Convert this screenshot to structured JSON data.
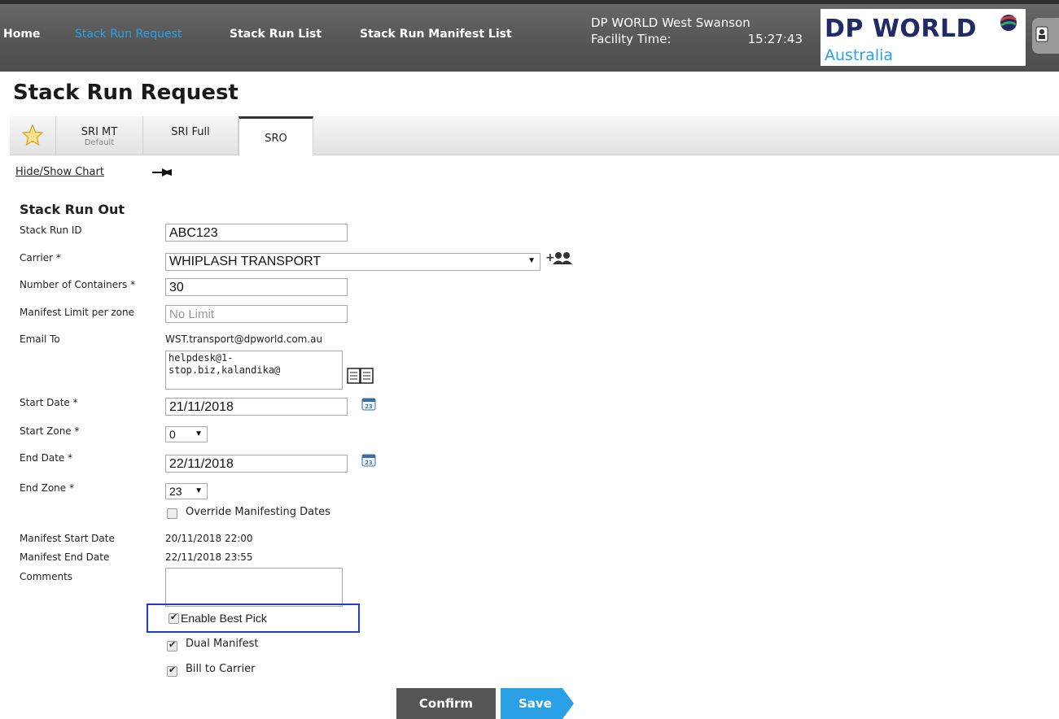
{
  "nav": {
    "home": "Home",
    "stack_run_request": "Stack Run Request",
    "stack_run_list": "Stack Run List",
    "stack_run_manifest_list": "Stack Run Manifest List"
  },
  "facility": {
    "name": "DP WORLD West Swanson",
    "time_label": "Facility Time:",
    "time": "15:27:43"
  },
  "logo": {
    "main": "DP WORLD",
    "sub": "Australia"
  },
  "page_title": "Stack Run Request",
  "tabs": [
    {
      "label": "SRI MT",
      "sub": "Default"
    },
    {
      "label": "SRI Full"
    },
    {
      "label": "SRO"
    }
  ],
  "hide_show_chart": "Hide/Show Chart",
  "section_title": "Stack Run Out",
  "form": {
    "stack_run_id": {
      "label": "Stack Run ID",
      "value": "ABC123"
    },
    "carrier": {
      "label": "Carrier *",
      "value": "WHIPLASH TRANSPORT"
    },
    "num_containers": {
      "label": "Number of Containers *",
      "value": "30"
    },
    "manifest_limit": {
      "label": "Manifest Limit per zone",
      "placeholder": "No Limit"
    },
    "email_to": {
      "label": "Email To",
      "value": "WST.transport@dpworld.com.au",
      "extra_line1": "helpdesk@1-",
      "extra_line2": "stop.biz,kalandika@"
    },
    "start_date": {
      "label": "Start Date *",
      "value": "21/11/2018"
    },
    "start_zone": {
      "label": "Start Zone *",
      "value": "0"
    },
    "end_date": {
      "label": "End Date *",
      "value": "22/11/2018"
    },
    "end_zone": {
      "label": "End Zone *",
      "value": "23"
    },
    "override": {
      "label": "Override Manifesting Dates",
      "checked": false
    },
    "manifest_start": {
      "label": "Manifest Start Date",
      "value": "20/11/2018 22:00"
    },
    "manifest_end": {
      "label": "Manifest End Date",
      "value": "22/11/2018 23:55"
    },
    "comments": {
      "label": "Comments",
      "value": ""
    },
    "enable_best_pick": {
      "label": "Enable Best Pick",
      "checked": true
    },
    "dual_manifest": {
      "label": "Dual Manifest",
      "checked": true
    },
    "bill_to_carrier": {
      "label": "Bill to Carrier",
      "checked": true
    }
  },
  "buttons": {
    "confirm": "Confirm",
    "save": "Save"
  },
  "colors": {
    "accent": "#2aa1e6",
    "topbar": "#555555",
    "highlight": "#1e3cd0",
    "logo_navy": "#1f2a66"
  }
}
